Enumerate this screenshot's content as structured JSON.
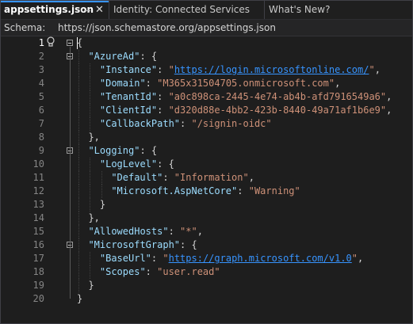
{
  "tabs": [
    {
      "label": "appsettings.json",
      "active": true,
      "pinned": true
    },
    {
      "label": "Identity: Connected Services",
      "active": false
    },
    {
      "label": "What's New?",
      "active": false
    }
  ],
  "tab_icons": {
    "pin": "pin-icon",
    "close": "close-icon"
  },
  "schema": {
    "label": "Schema:",
    "value": "https://json.schemastore.org/appsettings.json"
  },
  "editor": {
    "current_line": 1,
    "lines": [
      {
        "n": "1",
        "indent": 0,
        "fold": true,
        "tokens": [
          {
            "t": "p",
            "v": "{"
          }
        ]
      },
      {
        "n": "2",
        "indent": 1,
        "fold": true,
        "tokens": [
          {
            "t": "k",
            "v": "\"AzureAd\""
          },
          {
            "t": "p",
            "v": ": {"
          }
        ]
      },
      {
        "n": "3",
        "indent": 2,
        "tokens": [
          {
            "t": "k",
            "v": "\"Instance\""
          },
          {
            "t": "p",
            "v": ": "
          },
          {
            "t": "s",
            "v": "\""
          },
          {
            "t": "u",
            "v": "https://login.microsoftonline.com/"
          },
          {
            "t": "s",
            "v": "\""
          },
          {
            "t": "p",
            "v": ","
          }
        ]
      },
      {
        "n": "4",
        "indent": 2,
        "tokens": [
          {
            "t": "k",
            "v": "\"Domain\""
          },
          {
            "t": "p",
            "v": ": "
          },
          {
            "t": "s",
            "v": "\"M365x31504705.onmicrosoft.com\""
          },
          {
            "t": "p",
            "v": ","
          }
        ]
      },
      {
        "n": "5",
        "indent": 2,
        "tokens": [
          {
            "t": "k",
            "v": "\"TenantId\""
          },
          {
            "t": "p",
            "v": ": "
          },
          {
            "t": "s",
            "v": "\"a0c898ca-2445-4e74-ab4b-afd7916549a6\""
          },
          {
            "t": "p",
            "v": ","
          }
        ]
      },
      {
        "n": "6",
        "indent": 2,
        "tokens": [
          {
            "t": "k",
            "v": "\"ClientId\""
          },
          {
            "t": "p",
            "v": ": "
          },
          {
            "t": "s",
            "v": "\"d320d88e-4bb2-423b-8440-49a71af1b6e9\""
          },
          {
            "t": "p",
            "v": ","
          }
        ]
      },
      {
        "n": "7",
        "indent": 2,
        "tokens": [
          {
            "t": "k",
            "v": "\"CallbackPath\""
          },
          {
            "t": "p",
            "v": ": "
          },
          {
            "t": "s",
            "v": "\"/signin-oidc\""
          }
        ]
      },
      {
        "n": "8",
        "indent": 1,
        "tokens": [
          {
            "t": "p",
            "v": "},"
          }
        ]
      },
      {
        "n": "9",
        "indent": 1,
        "fold": true,
        "tokens": [
          {
            "t": "k",
            "v": "\"Logging\""
          },
          {
            "t": "p",
            "v": ": {"
          }
        ]
      },
      {
        "n": "10",
        "indent": 2,
        "tokens": [
          {
            "t": "k",
            "v": "\"LogLevel\""
          },
          {
            "t": "p",
            "v": ": {"
          }
        ]
      },
      {
        "n": "11",
        "indent": 3,
        "tokens": [
          {
            "t": "k",
            "v": "\"Default\""
          },
          {
            "t": "p",
            "v": ": "
          },
          {
            "t": "s",
            "v": "\"Information\""
          },
          {
            "t": "p",
            "v": ","
          }
        ]
      },
      {
        "n": "12",
        "indent": 3,
        "tokens": [
          {
            "t": "k",
            "v": "\"Microsoft.AspNetCore\""
          },
          {
            "t": "p",
            "v": ": "
          },
          {
            "t": "s",
            "v": "\"Warning\""
          }
        ]
      },
      {
        "n": "13",
        "indent": 2,
        "tokens": [
          {
            "t": "p",
            "v": "}"
          }
        ]
      },
      {
        "n": "14",
        "indent": 1,
        "tokens": [
          {
            "t": "p",
            "v": "},"
          }
        ]
      },
      {
        "n": "15",
        "indent": 1,
        "tokens": [
          {
            "t": "k",
            "v": "\"AllowedHosts\""
          },
          {
            "t": "p",
            "v": ": "
          },
          {
            "t": "s",
            "v": "\"*\""
          },
          {
            "t": "p",
            "v": ","
          }
        ]
      },
      {
        "n": "16",
        "indent": 1,
        "fold": true,
        "tokens": [
          {
            "t": "k",
            "v": "\"MicrosoftGraph\""
          },
          {
            "t": "p",
            "v": ": {"
          }
        ]
      },
      {
        "n": "17",
        "indent": 2,
        "tokens": [
          {
            "t": "k",
            "v": "\"BaseUrl\""
          },
          {
            "t": "p",
            "v": ": "
          },
          {
            "t": "s",
            "v": "\""
          },
          {
            "t": "u",
            "v": "https://graph.microsoft.com/v1.0"
          },
          {
            "t": "s",
            "v": "\""
          },
          {
            "t": "p",
            "v": ","
          }
        ]
      },
      {
        "n": "18",
        "indent": 2,
        "tokens": [
          {
            "t": "k",
            "v": "\"Scopes\""
          },
          {
            "t": "p",
            "v": ": "
          },
          {
            "t": "s",
            "v": "\"user.read\""
          }
        ]
      },
      {
        "n": "19",
        "indent": 1,
        "tokens": [
          {
            "t": "p",
            "v": "}"
          }
        ]
      },
      {
        "n": "20",
        "indent": 0,
        "tokens": [
          {
            "t": "p",
            "v": "}"
          }
        ]
      }
    ]
  },
  "colors": {
    "accent": "#3794ff",
    "key": "#9cdcfe",
    "string": "#ce9178",
    "background": "#1e1e1e"
  }
}
